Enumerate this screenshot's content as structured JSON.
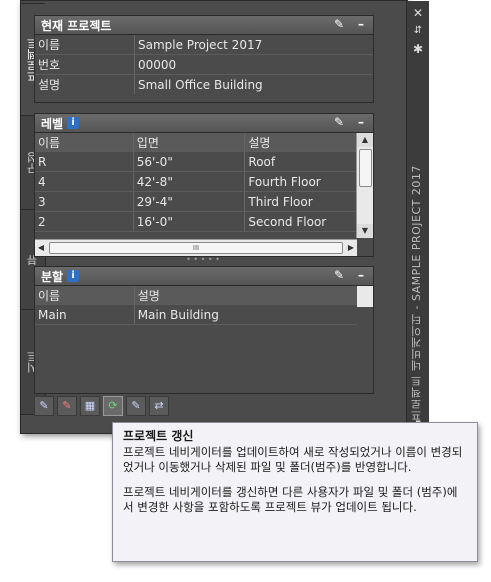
{
  "palette": {
    "vertical_title": "프로젝트 네비게이터 - SAMPLE PROJECT 2017",
    "titlebar_buttons": [
      "close-icon",
      "autohide-icon",
      "properties-icon"
    ],
    "tabs": [
      {
        "label": "프로젝트",
        "active": true
      },
      {
        "label": "구성",
        "active": false
      },
      {
        "label": "뷰",
        "active": false
      },
      {
        "label": "시트",
        "active": false
      }
    ]
  },
  "current_project": {
    "title": "현재 프로젝트",
    "rows": [
      {
        "key": "이름",
        "value": "Sample Project 2017"
      },
      {
        "key": "번호",
        "value": "00000"
      },
      {
        "key": "설명",
        "value": "Small Office Building"
      }
    ]
  },
  "levels": {
    "title": "레벨",
    "columns": [
      "이름",
      "입면",
      "설명"
    ],
    "rows": [
      [
        "R",
        "56'-0\"",
        "Roof"
      ],
      [
        "4",
        "42'-8\"",
        "Fourth Floor"
      ],
      [
        "3",
        "29'-4\"",
        "Third Floor"
      ],
      [
        "2",
        "16'-0\"",
        "Second Floor"
      ]
    ],
    "scroll_thumb_grip": "III"
  },
  "divisions": {
    "title": "분할",
    "columns": [
      "이름",
      "설명"
    ],
    "rows": [
      [
        "Main",
        "Main Building"
      ]
    ]
  },
  "header_controls": {
    "edit_icon": "pencil-icon",
    "minimize": "–"
  },
  "toolbar": [
    "project-settings-icon",
    "close-project-icon",
    "project-browser-icon",
    "refresh-icon",
    "regenerate-icon",
    "repath-icon"
  ],
  "tooltip": {
    "title": "프로젝트 갱신",
    "para1": "프로젝트 네비게이터를 업데이트하여 새로 작성되었거나 이름이 변경되었거나 이동했거나 삭제된 파일 및 폴더(범주)를 반영합니다.",
    "para2": "프로젝트 네비게이터를 갱신하면 다른 사용자가 파일 및 폴더 (범주)에서 변경한 사항을 포함하도록 프로젝트 뷰가 업데이트 됩니다."
  }
}
